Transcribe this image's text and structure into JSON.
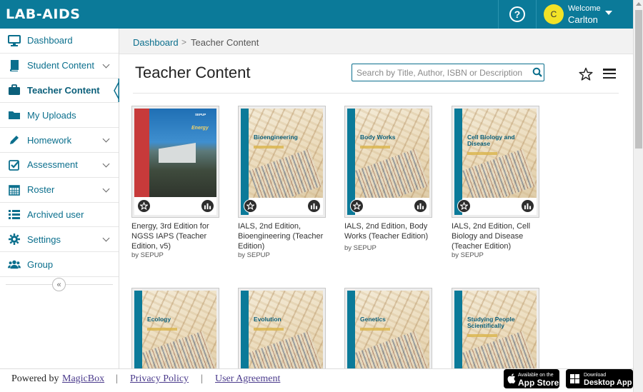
{
  "header": {
    "logo": "LAB-AIDS",
    "help_symbol": "?",
    "welcome_label": "Welcome",
    "user_initial": "C",
    "user_name": "Carlton",
    "brand_color": "#0b7a99"
  },
  "sidebar": {
    "items": [
      {
        "label": "Dashboard",
        "icon": "monitor-icon",
        "chevron": false,
        "active": false
      },
      {
        "label": "Student Content",
        "icon": "book-icon",
        "chevron": true,
        "active": false
      },
      {
        "label": "Teacher Content",
        "icon": "briefcase-icon",
        "chevron": false,
        "active": true
      },
      {
        "label": "My Uploads",
        "icon": "folder-icon",
        "chevron": false,
        "active": false
      },
      {
        "label": "Homework",
        "icon": "pencil-icon",
        "chevron": true,
        "active": false
      },
      {
        "label": "Assessment",
        "icon": "checkbox-icon",
        "chevron": true,
        "active": false
      },
      {
        "label": "Roster",
        "icon": "calendar-icon",
        "chevron": true,
        "active": false
      },
      {
        "label": "Archived user",
        "icon": "list-icon",
        "chevron": false,
        "active": false
      },
      {
        "label": "Settings",
        "icon": "gear-icon",
        "chevron": true,
        "active": false
      },
      {
        "label": "Group",
        "icon": "users-icon",
        "chevron": false,
        "active": false
      }
    ],
    "collapse_symbol": "«"
  },
  "breadcrumb": {
    "home": "Dashboard",
    "separator": ">",
    "current": "Teacher Content"
  },
  "main": {
    "title": "Teacher Content",
    "search_placeholder": "Search by Title, Author, ISBN or Description"
  },
  "books": [
    {
      "title": "Energy, 3rd Edition for NGSS IAPS (Teacher Edition, v5)",
      "author": "by SEPUP",
      "cover_type": "energy",
      "cover_title": "Energy",
      "cover_brand": "SEPUP"
    },
    {
      "title": "IALS, 2nd Edition, Bioengineering (Teacher Edition)",
      "author": "by SEPUP",
      "cover_type": "ials",
      "cover_title": "Bioengineering"
    },
    {
      "title": "IALS, 2nd Edition, Body Works (Teacher Edition)",
      "author": "by SEPUP",
      "cover_type": "ials",
      "cover_title": "Body Works"
    },
    {
      "title": "IALS, 2nd Edition, Cell Biology and Disease (Teacher Edition)",
      "author": "by SEPUP",
      "cover_type": "ials",
      "cover_title": "Cell Biology and Disease"
    },
    {
      "title": "",
      "author": "",
      "cover_type": "ials",
      "cover_title": "Ecology"
    },
    {
      "title": "",
      "author": "",
      "cover_type": "ials",
      "cover_title": "Evolution"
    },
    {
      "title": "",
      "author": "",
      "cover_type": "ials",
      "cover_title": "Genetics"
    },
    {
      "title": "",
      "author": "",
      "cover_type": "ials",
      "cover_title": "Studying People Scientifically"
    }
  ],
  "footer": {
    "powered_by": "Powered by",
    "powered_link": "MagicBox",
    "privacy": "Privacy Policy",
    "agreement": "User Agreement",
    "sep": "|",
    "appstore_small": "Available on the",
    "appstore_big": "App Store",
    "desktop_small": "Download",
    "desktop_big": "Desktop App"
  }
}
